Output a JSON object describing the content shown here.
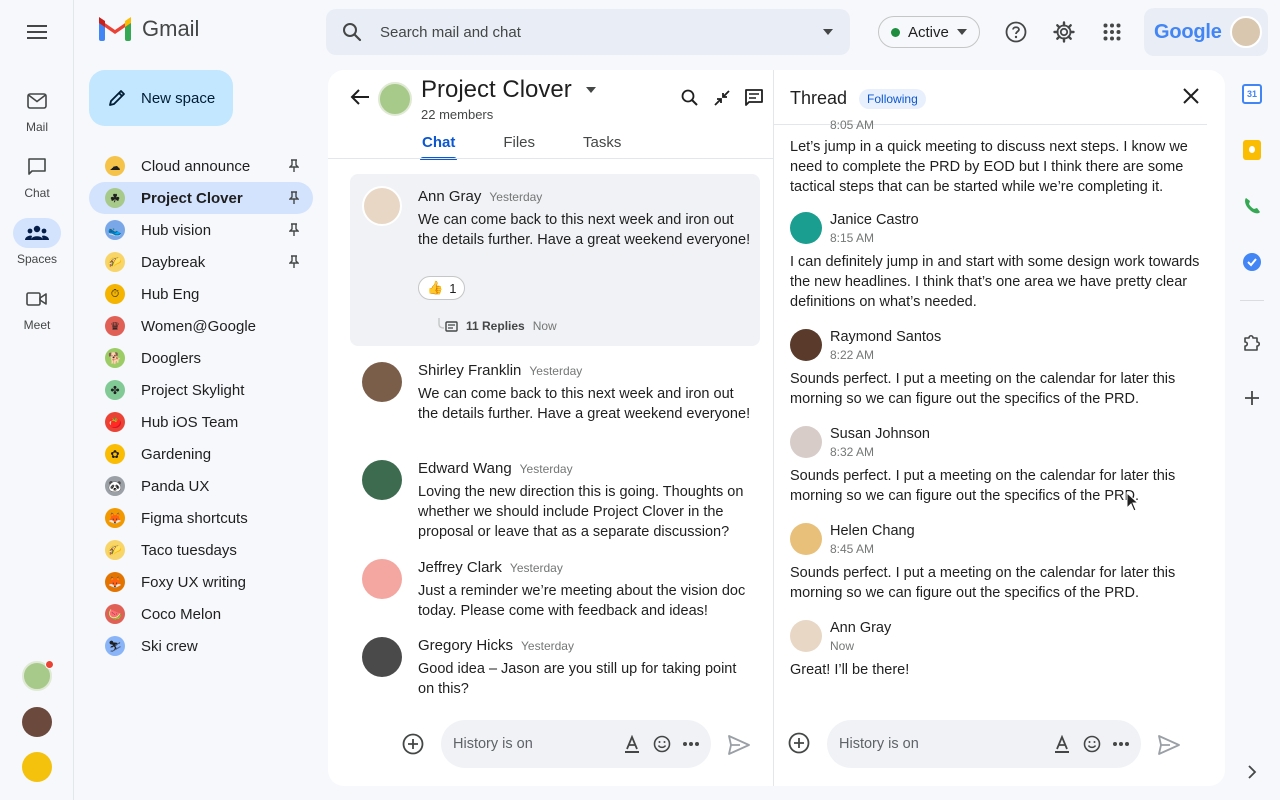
{
  "app": {
    "name": "Gmail"
  },
  "rail": {
    "items": [
      {
        "label": "Mail",
        "icon": "mail-icon"
      },
      {
        "label": "Chat",
        "icon": "chat-icon"
      },
      {
        "label": "Spaces",
        "icon": "spaces-icon"
      },
      {
        "label": "Meet",
        "icon": "video-icon"
      }
    ]
  },
  "header": {
    "search_placeholder": "Search mail and chat",
    "status": "Active",
    "brand": "Google"
  },
  "nav": {
    "new_space": "New space",
    "spaces": [
      {
        "label": "Cloud announce",
        "pinned": true,
        "color": "#f6c34a",
        "glyph": "☁"
      },
      {
        "label": "Project Clover",
        "pinned": true,
        "color": "#a7c98a",
        "glyph": "☘"
      },
      {
        "label": "Hub vision",
        "pinned": true,
        "color": "#7aa7e8",
        "glyph": "👟"
      },
      {
        "label": "Daybreak",
        "pinned": true,
        "color": "#f8d568",
        "glyph": "🌮"
      },
      {
        "label": "Hub Eng",
        "pinned": false,
        "color": "#f4b400",
        "glyph": "⏱"
      },
      {
        "label": "Women@Google",
        "pinned": false,
        "color": "#e06055",
        "glyph": "♛"
      },
      {
        "label": "Dooglers",
        "pinned": false,
        "color": "#9ccc65",
        "glyph": "🐕"
      },
      {
        "label": "Project Skylight",
        "pinned": false,
        "color": "#81c995",
        "glyph": "✤"
      },
      {
        "label": "Hub iOS Team",
        "pinned": false,
        "color": "#ea4335",
        "glyph": "🍅"
      },
      {
        "label": "Gardening",
        "pinned": false,
        "color": "#fbbc04",
        "glyph": "✿"
      },
      {
        "label": "Panda UX",
        "pinned": false,
        "color": "#9aa0a6",
        "glyph": "🐼"
      },
      {
        "label": "Figma shortcuts",
        "pinned": false,
        "color": "#f29900",
        "glyph": "🦊"
      },
      {
        "label": "Taco tuesdays",
        "pinned": false,
        "color": "#f8d568",
        "glyph": "🌮"
      },
      {
        "label": "Foxy UX writing",
        "pinned": false,
        "color": "#e37400",
        "glyph": "🦊"
      },
      {
        "label": "Coco Melon",
        "pinned": false,
        "color": "#e06055",
        "glyph": "🍉"
      },
      {
        "label": "Ski crew",
        "pinned": false,
        "color": "#8ab4f8",
        "glyph": "⛷"
      }
    ]
  },
  "chat": {
    "title": "Project Clover",
    "members": "22 members",
    "tabs": [
      "Chat",
      "Files",
      "Tasks"
    ],
    "messages": [
      {
        "name": "Ann Gray",
        "time": "Yesterday",
        "body": "We can come back to this next week and iron out the details further. Have a great weekend everyone!",
        "reaction": "1",
        "replies": "11 Replies",
        "replies_time": "Now"
      },
      {
        "name": "Shirley Franklin",
        "time": "Yesterday",
        "body": "We can come back to this next week and iron out the details further. Have a great weekend everyone!"
      },
      {
        "name": "Edward Wang",
        "time": "Yesterday",
        "body": "Loving the new direction this is going. Thoughts on whether we should include Project Clover in the proposal or leave that as a separate discussion?"
      },
      {
        "name": "Jeffrey Clark",
        "time": "Yesterday",
        "body": "Just a reminder we’re meeting about the vision doc today. Please come with feedback and ideas!"
      },
      {
        "name": "Gregory Hicks",
        "time": "Yesterday",
        "body": "Good idea – Jason are you still up for taking point on this?"
      }
    ],
    "composer_placeholder": "History is on"
  },
  "thread": {
    "title": "Thread",
    "following": "Following",
    "top_time": "8:05 AM",
    "top_body": "Let’s jump in a quick meeting to discuss next steps. I know we need to complete the PRD by EOD but I think there are some tactical steps that can be started while we’re completing it.",
    "messages": [
      {
        "name": "Janice Castro",
        "time": "8:15 AM",
        "body": "I can definitely jump in and start with some design work towards the new headlines. I think that’s one area we have pretty clear definitions on what’s needed."
      },
      {
        "name": "Raymond Santos",
        "time": "8:22 AM",
        "body": "Sounds perfect. I put a meeting on the calendar for later this morning so we can figure out the specifics of the PRD."
      },
      {
        "name": "Susan Johnson",
        "time": "8:32 AM",
        "body": "Sounds perfect. I put a meeting on the calendar for later this morning so we can figure out the specifics of the PRD."
      },
      {
        "name": "Helen Chang",
        "time": "8:45 AM",
        "body": "Sounds perfect. I put a meeting on the calendar for later this morning so we can figure out the specifics of the PRD."
      },
      {
        "name": "Ann Gray",
        "time": "Now",
        "body": "Great! I’ll be there!"
      }
    ],
    "composer_placeholder": "History is on"
  },
  "right_rail": {
    "calendar_day": "31"
  },
  "colors": {
    "accent": "#0b57d0",
    "active_bg": "#d3e3fd",
    "new_space_bg": "#c2e7ff",
    "status_green": "#1e8e3e"
  }
}
